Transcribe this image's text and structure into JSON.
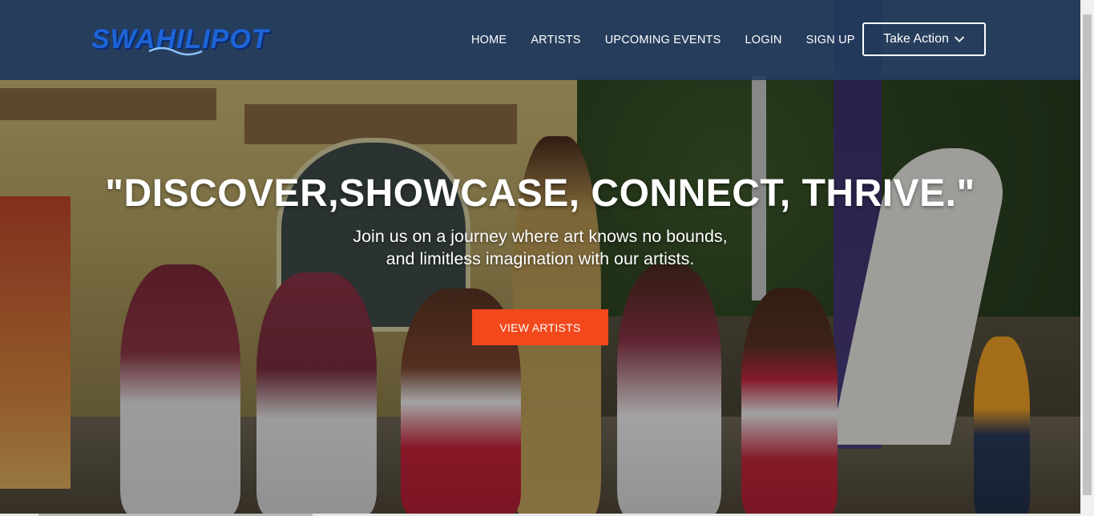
{
  "brand": {
    "logo_text": "SWAHILIPOT"
  },
  "nav": {
    "links": [
      "HOME",
      "ARTISTS",
      "UPCOMING EVENTS",
      "LOGIN",
      "SIGN UP"
    ],
    "take_action_label": "Take Action"
  },
  "hero": {
    "headline": "\"DISCOVER,SHOWCASE, CONNECT, THRIVE.\"",
    "subtitle_line1": "Join us on a journey where art knows no bounds,",
    "subtitle_line2": "and limitless imagination with our artists.",
    "cta_label": "VIEW ARTISTS"
  },
  "colors": {
    "nav_bg": "#223c60",
    "cta_bg": "#f2481c",
    "logo": "#1e64d6"
  },
  "icons": {
    "take_action": "chevron-down-icon"
  }
}
